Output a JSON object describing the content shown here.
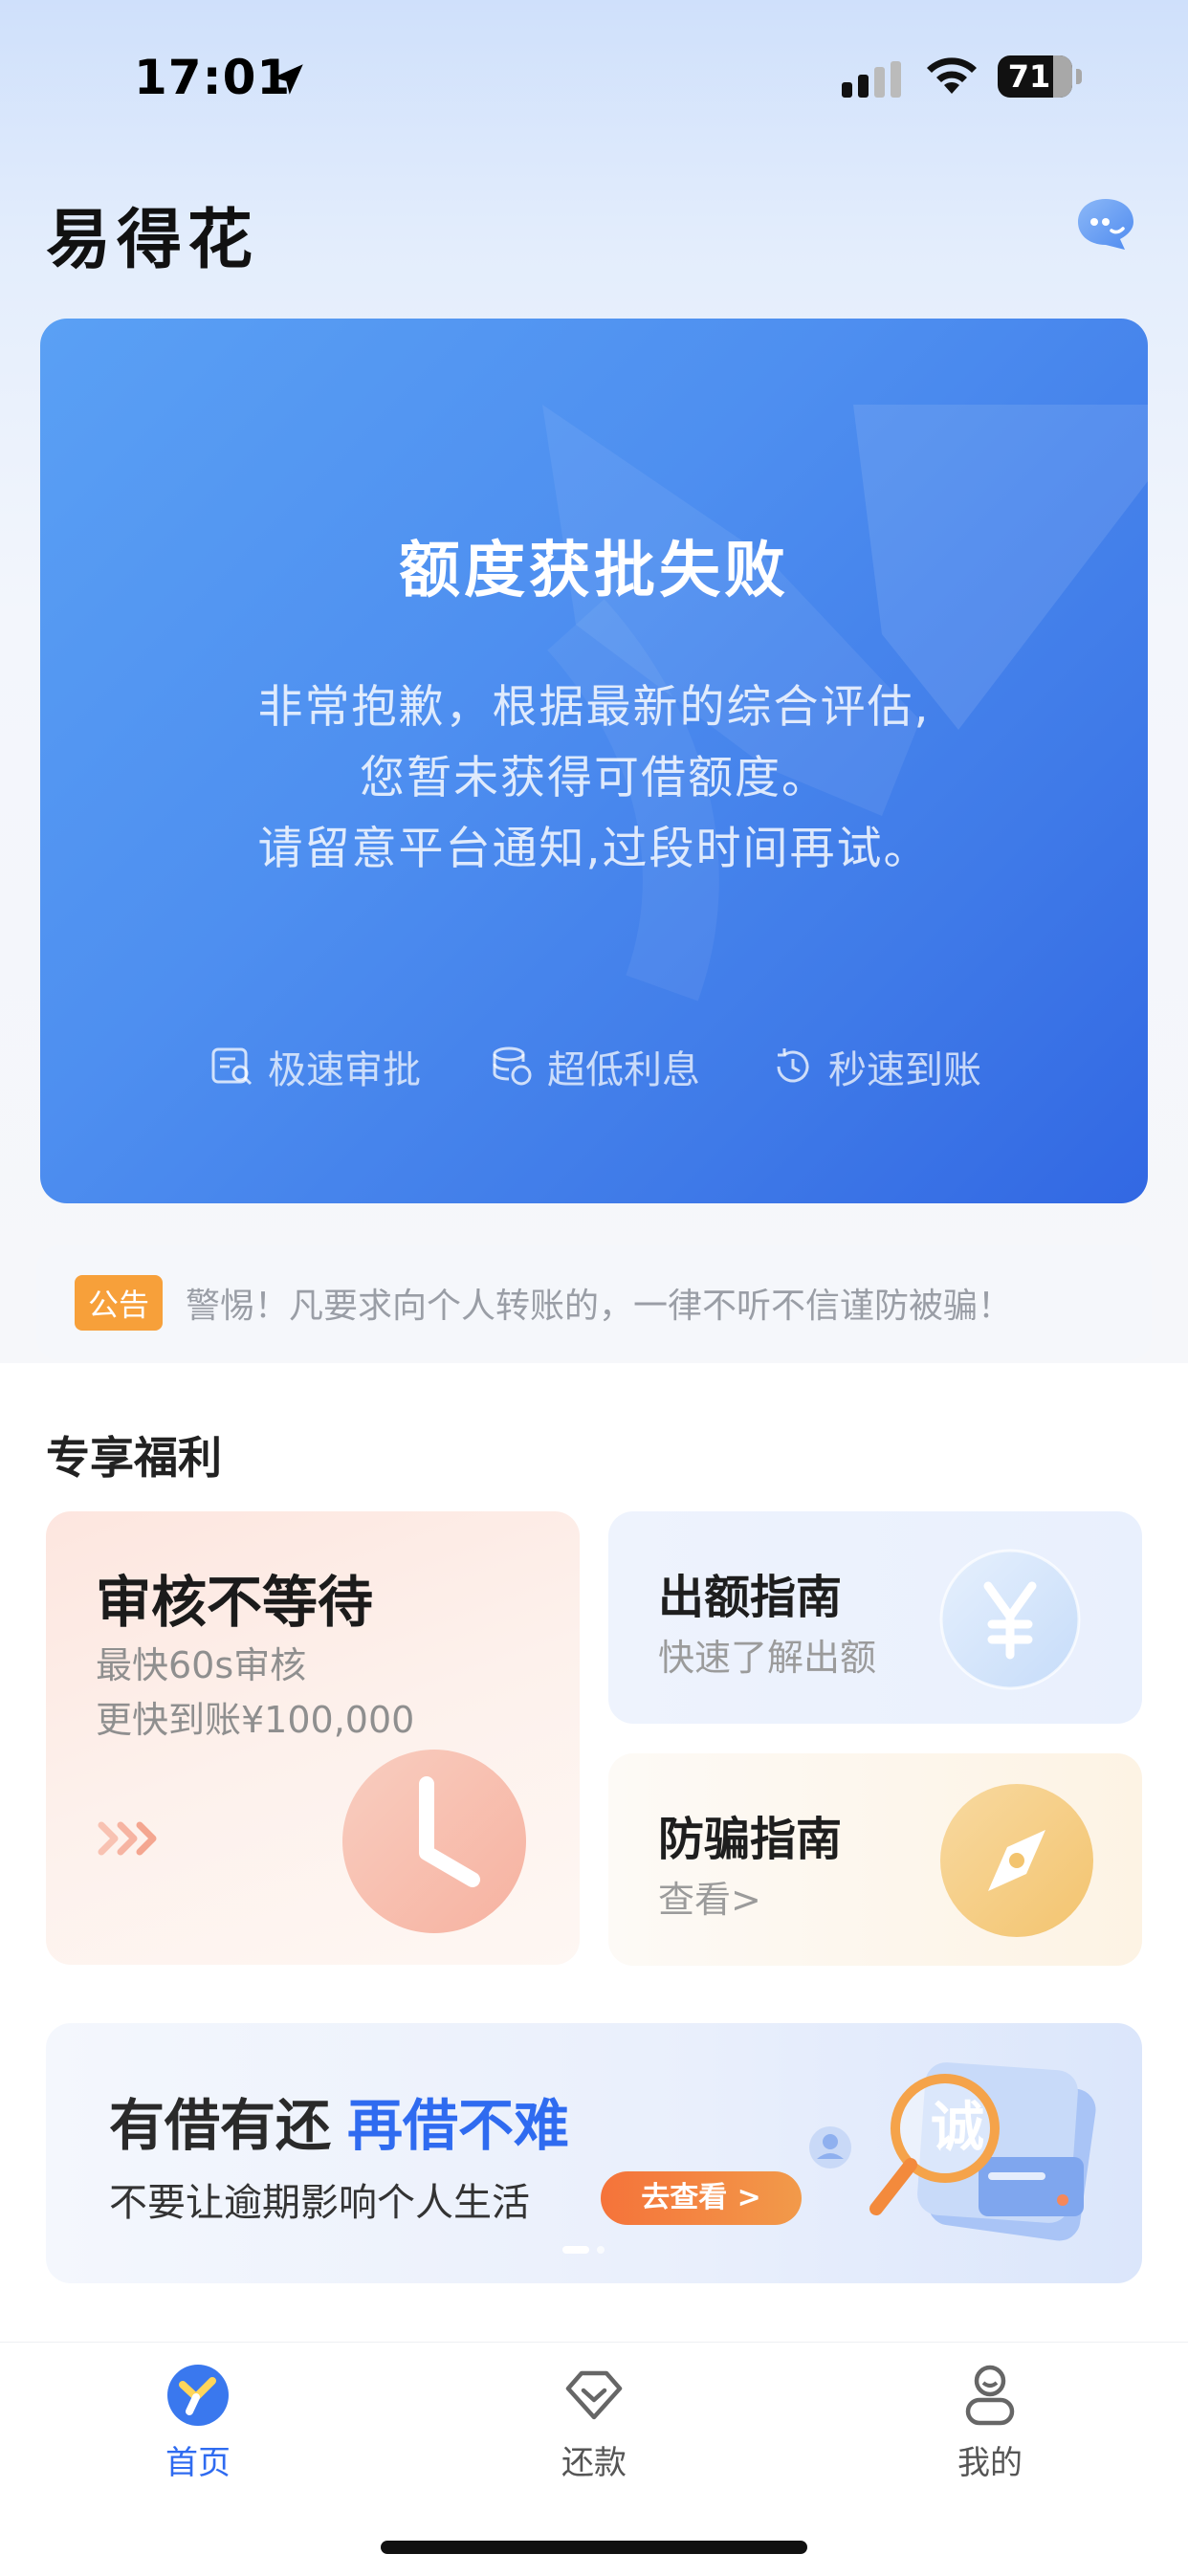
{
  "status_bar": {
    "time": "17:01",
    "battery": "71"
  },
  "header": {
    "title": "易得花",
    "chat_icon": "chat-bubble-icon"
  },
  "hero": {
    "title": "额度获批失败",
    "lines": [
      "非常抱歉，根据最新的综合评估,",
      "您暂未获得可借额度。",
      "请留意平台通知,过段时间再试。"
    ],
    "features": [
      {
        "label": "极速审批",
        "icon": "review-doc-icon"
      },
      {
        "label": "超低利息",
        "icon": "coins-icon"
      },
      {
        "label": "秒速到账",
        "icon": "clock-refresh-icon"
      }
    ],
    "colors": {
      "start": "#5aa0f4",
      "end": "#3268e3"
    }
  },
  "notice": {
    "badge": "公告",
    "text": "警惕！凡要求向个人转账的，一律不听不信谨防被骗！"
  },
  "benefits": {
    "title": "专享福利",
    "review_card": {
      "title": "审核不等待",
      "line1": "最快60s审核",
      "line2": "更快到账¥100,000"
    },
    "guide_card": {
      "title": "出额指南",
      "subtitle": "快速了解出额"
    },
    "fraud_card": {
      "title": "防骗指南",
      "subtitle": "查看>"
    }
  },
  "banner": {
    "heading_a": "有借有还",
    "heading_b": "再借不难",
    "subtitle": "不要让逾期影响个人生活",
    "button": "去查看 >",
    "accent": "#2f6bf0"
  },
  "tabs": [
    {
      "label": "首页",
      "icon": "home-logo-icon",
      "active": true
    },
    {
      "label": "还款",
      "icon": "repay-icon",
      "active": false
    },
    {
      "label": "我的",
      "icon": "profile-icon",
      "active": false
    }
  ]
}
